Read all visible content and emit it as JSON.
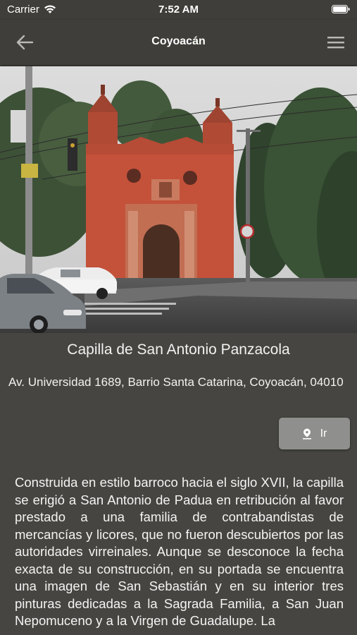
{
  "status_bar": {
    "carrier": "Carrier",
    "time": "7:52 AM"
  },
  "nav_bar": {
    "title": "Coyoacán",
    "back_icon": "arrow-left-icon",
    "menu_icon": "hamburger-menu-icon"
  },
  "hero_image": {
    "description_icon": "church-photo"
  },
  "place": {
    "name": "Capilla de San Antonio Panzacola",
    "address": "Av. Universidad 1689, Barrio Santa Catarina, Coyoacán, 04010"
  },
  "go_button": {
    "label": "Ir",
    "icon": "map-pin-icon"
  },
  "description": "Construida en estilo barroco hacia el siglo XVII, la capilla se erigió a San Antonio de Padua en retribución al favor prestado a una familia de contrabandistas de mercancías y licores, que no fueron descubiertos por las autoridades virreinales. Aunque se desconoce la fecha exacta de su construcción, en su portada se encuentra una imagen de San Sebastián y en su interior tres pinturas dedicadas a la Sagrada Familia, a San Juan Nepomuceno y a la Virgen de Guadalupe. La",
  "colors": {
    "background": "#464541",
    "nav_bar": "#3f3e3a",
    "button": "#8f8f8d",
    "church": "#c4513a"
  }
}
